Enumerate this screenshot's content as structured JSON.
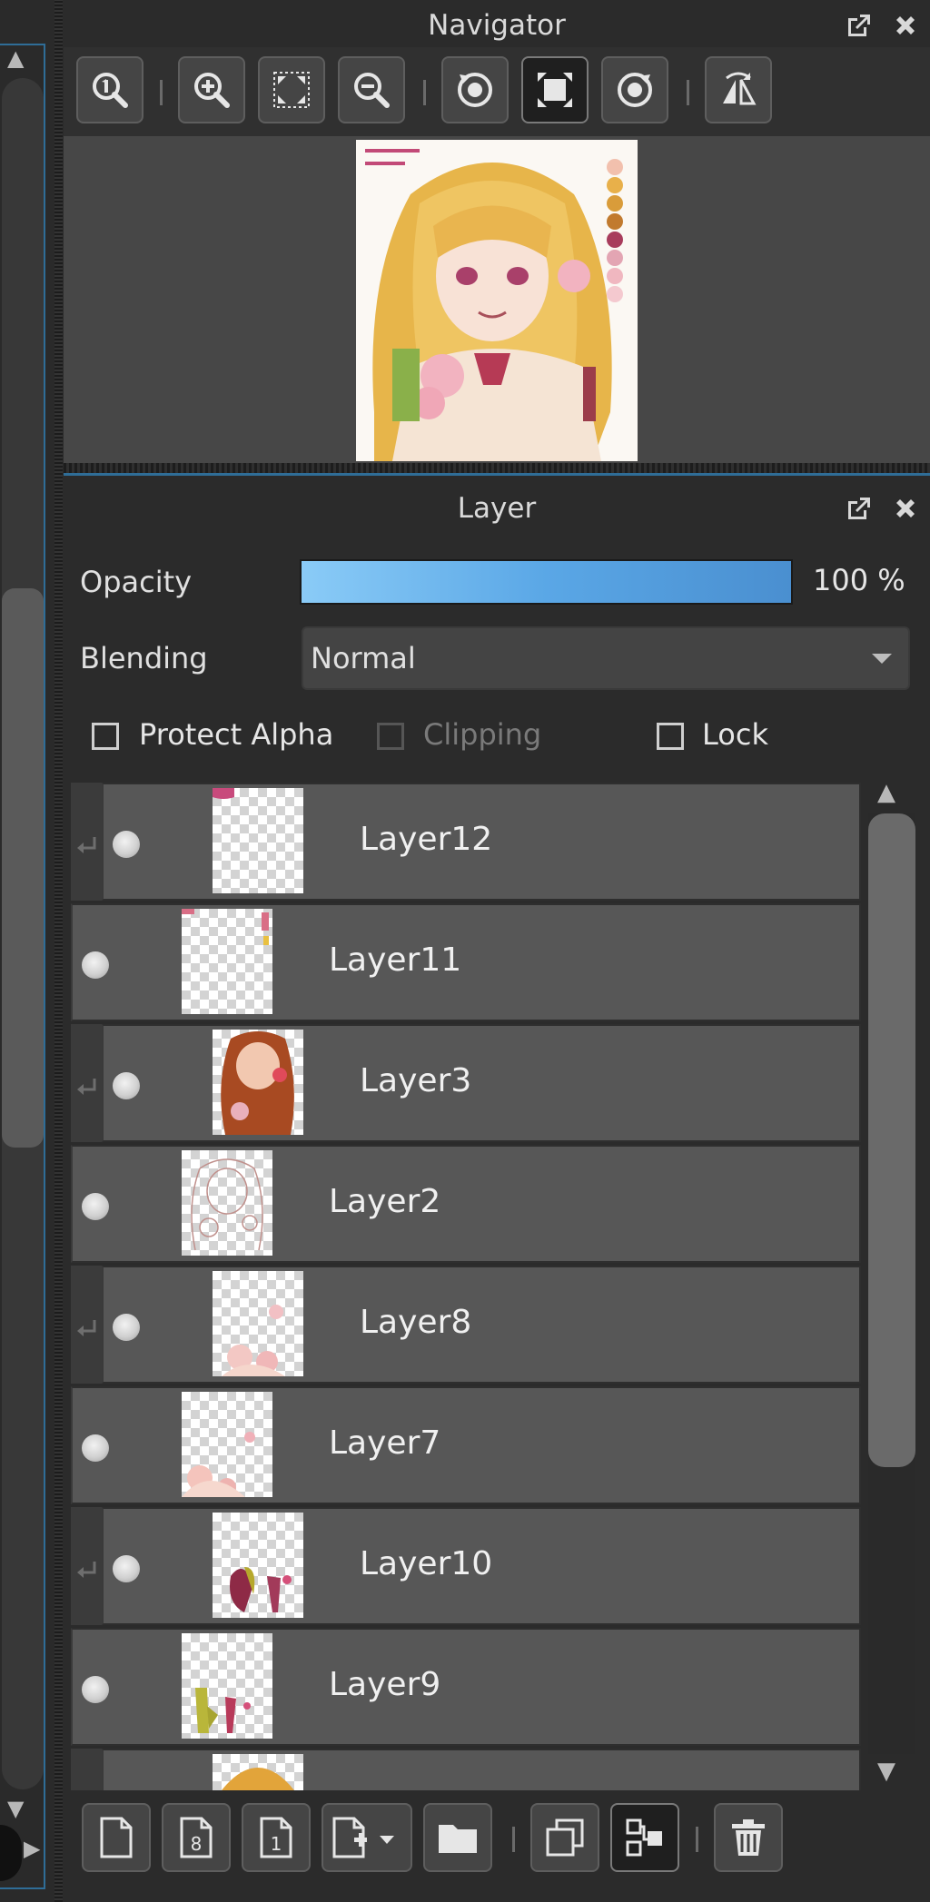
{
  "navigator": {
    "title": "Navigator",
    "toolbar": [
      "zoom-actual-icon",
      "zoom-in-icon",
      "fit-window-icon",
      "zoom-out-icon",
      "rotate-left-icon",
      "fit-canvas-icon",
      "rotate-right-icon",
      "flip-horizontal-icon"
    ]
  },
  "layer_panel": {
    "title": "Layer",
    "opacity_label": "Opacity",
    "opacity_value": "100 %",
    "opacity_fraction": 1.0,
    "blending_label": "Blending",
    "blending_value": "Normal",
    "protect_alpha_label": "Protect Alpha",
    "clipping_label": "Clipping",
    "lock_label": "Lock",
    "protect_alpha_checked": false,
    "clipping_checked": false,
    "lock_checked": false,
    "layers": [
      {
        "name": "Layer12",
        "clipped": true,
        "visible": true
      },
      {
        "name": "Layer11",
        "clipped": false,
        "visible": true
      },
      {
        "name": "Layer3",
        "clipped": true,
        "visible": true
      },
      {
        "name": "Layer2",
        "clipped": false,
        "visible": true
      },
      {
        "name": "Layer8",
        "clipped": true,
        "visible": true
      },
      {
        "name": "Layer7",
        "clipped": false,
        "visible": true
      },
      {
        "name": "Layer10",
        "clipped": true,
        "visible": true
      },
      {
        "name": "Layer9",
        "clipped": false,
        "visible": true
      }
    ],
    "bottom_toolbar": [
      "new-layer-icon",
      "new-8bit-layer-icon",
      "new-1bit-layer-icon",
      "add-layer-menu-icon",
      "new-folder-icon",
      "duplicate-layer-icon",
      "merge-down-icon",
      "delete-layer-icon"
    ]
  },
  "colors": {
    "accent": "#2f6d97",
    "opacity_bar": "#5aa7e6",
    "row_bg": "#575757"
  }
}
